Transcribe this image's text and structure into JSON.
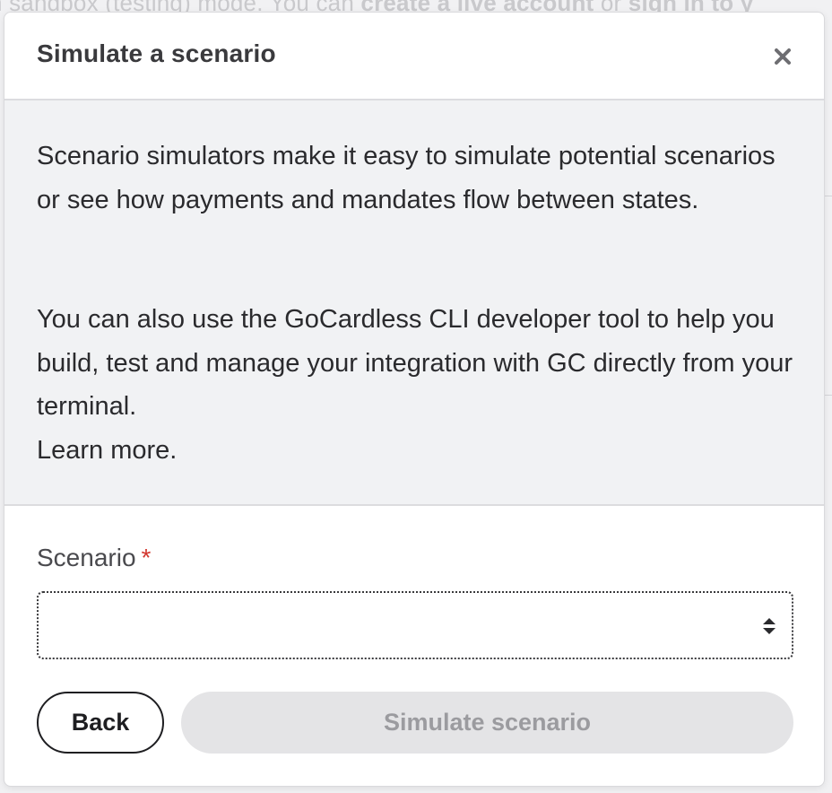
{
  "background": {
    "text_segments": [
      {
        "text": "n sandbox (testing) mode. You can ",
        "bold": false
      },
      {
        "text": "create a live account",
        "bold": true
      },
      {
        "text": " or ",
        "bold": false
      },
      {
        "text": "sign in to y",
        "bold": true
      }
    ]
  },
  "modal": {
    "title": "Simulate a scenario",
    "close_icon": "close-icon",
    "info": {
      "paragraph_1": "Scenario simulators make it easy to simulate potential scenarios or see how payments and mandates flow between states.",
      "paragraph_2": "You can also use the GoCardless CLI developer tool to help you build, test and manage your integration with GC directly from your terminal.",
      "learn_more": "Learn more."
    },
    "form": {
      "scenario_label": "Scenario",
      "required_marker": "*",
      "scenario_value": "",
      "select_icon": "up-down-arrows-icon"
    },
    "buttons": {
      "back_label": "Back",
      "simulate_label": "Simulate scenario",
      "simulate_disabled": true
    }
  },
  "colors": {
    "required": "#d2362e",
    "info_background": "#f1f2f4",
    "disabled_button_bg": "#e4e4e6",
    "disabled_button_text": "#9b9b9f"
  }
}
